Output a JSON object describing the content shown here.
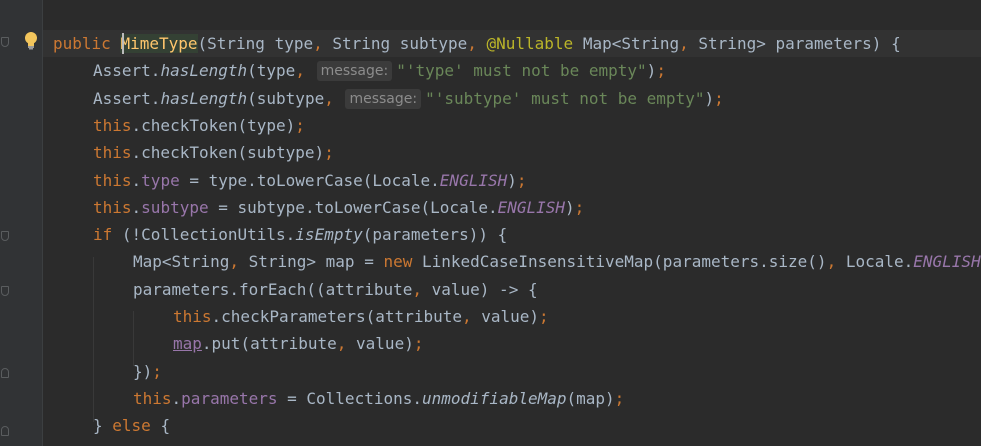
{
  "editor": {
    "lines": [
      {
        "tokens": [
          {
            "t": "public ",
            "c": "kw"
          },
          {
            "t": "MimeType",
            "c": "fn mime-hl"
          },
          {
            "t": "(String type",
            "c": ""
          },
          {
            "t": ", ",
            "c": "kw"
          },
          {
            "t": "String subtype",
            "c": ""
          },
          {
            "t": ", ",
            "c": "kw"
          },
          {
            "t": "@Nullable ",
            "c": "ann"
          },
          {
            "t": "Map<String",
            "c": ""
          },
          {
            "t": ", ",
            "c": "kw"
          },
          {
            "t": "String> parameters) {",
            "c": ""
          }
        ]
      },
      {
        "tokens": [
          {
            "t": "Assert.",
            "c": ""
          },
          {
            "t": "hasLength",
            "c": "static-m"
          },
          {
            "t": "(type",
            "c": ""
          },
          {
            "t": ", ",
            "c": "kw"
          },
          {
            "hint": "message:"
          },
          {
            "t": "\"'type' must not be empty\"",
            "c": "str"
          },
          {
            "t": ")",
            "c": ""
          },
          {
            "t": ";",
            "c": "kw"
          }
        ]
      },
      {
        "tokens": [
          {
            "t": "Assert.",
            "c": ""
          },
          {
            "t": "hasLength",
            "c": "static-m"
          },
          {
            "t": "(subtype",
            "c": ""
          },
          {
            "t": ", ",
            "c": "kw"
          },
          {
            "hint": "message:"
          },
          {
            "t": "\"'subtype' must not be empty\"",
            "c": "str"
          },
          {
            "t": ")",
            "c": ""
          },
          {
            "t": ";",
            "c": "kw"
          }
        ]
      },
      {
        "tokens": [
          {
            "t": "this",
            "c": "kw"
          },
          {
            "t": ".checkToken(type)",
            "c": ""
          },
          {
            "t": ";",
            "c": "kw"
          }
        ]
      },
      {
        "tokens": [
          {
            "t": "this",
            "c": "kw"
          },
          {
            "t": ".checkToken(subtype)",
            "c": ""
          },
          {
            "t": ";",
            "c": "kw"
          }
        ]
      },
      {
        "tokens": [
          {
            "t": "this",
            "c": "kw"
          },
          {
            "t": ".",
            "c": ""
          },
          {
            "t": "type",
            "c": "fld"
          },
          {
            "t": " = type.toLowerCase(Locale.",
            "c": ""
          },
          {
            "t": "ENGLISH",
            "c": "static-fld"
          },
          {
            "t": ")",
            "c": ""
          },
          {
            "t": ";",
            "c": "kw"
          }
        ]
      },
      {
        "tokens": [
          {
            "t": "this",
            "c": "kw"
          },
          {
            "t": ".",
            "c": ""
          },
          {
            "t": "subtype",
            "c": "fld"
          },
          {
            "t": " = subtype.toLowerCase(Locale.",
            "c": ""
          },
          {
            "t": "ENGLISH",
            "c": "static-fld"
          },
          {
            "t": ")",
            "c": ""
          },
          {
            "t": ";",
            "c": "kw"
          }
        ]
      },
      {
        "tokens": [
          {
            "t": "if ",
            "c": "kw"
          },
          {
            "t": "(!CollectionUtils.",
            "c": ""
          },
          {
            "t": "isEmpty",
            "c": "static-m"
          },
          {
            "t": "(parameters)) {",
            "c": ""
          }
        ]
      },
      {
        "tokens": [
          {
            "t": "Map<String",
            "c": ""
          },
          {
            "t": ", ",
            "c": "kw"
          },
          {
            "t": "String> map = ",
            "c": ""
          },
          {
            "t": "new ",
            "c": "kw"
          },
          {
            "t": "LinkedCaseInsensitiveMap(parameters.size()",
            "c": ""
          },
          {
            "t": ", ",
            "c": "kw"
          },
          {
            "t": "Locale.",
            "c": ""
          },
          {
            "t": "ENGLISH",
            "c": "static-fld"
          },
          {
            "t": "))",
            "c": ""
          },
          {
            "t": ";",
            "c": "kw"
          }
        ]
      },
      {
        "tokens": [
          {
            "t": "parameters.forEach((attribute",
            "c": ""
          },
          {
            "t": ", ",
            "c": "kw"
          },
          {
            "t": "value) -> {",
            "c": ""
          }
        ]
      },
      {
        "tokens": [
          {
            "t": "this",
            "c": "kw"
          },
          {
            "t": ".checkParameters(attribute",
            "c": ""
          },
          {
            "t": ", ",
            "c": "kw"
          },
          {
            "t": "value)",
            "c": ""
          },
          {
            "t": ";",
            "c": "kw"
          }
        ]
      },
      {
        "tokens": [
          {
            "t": "map",
            "c": "map-ref"
          },
          {
            "t": ".put(attribute",
            "c": ""
          },
          {
            "t": ", ",
            "c": "kw"
          },
          {
            "t": "value)",
            "c": ""
          },
          {
            "t": ";",
            "c": "kw"
          }
        ]
      },
      {
        "tokens": [
          {
            "t": "})",
            "c": ""
          },
          {
            "t": ";",
            "c": "kw"
          }
        ]
      },
      {
        "tokens": [
          {
            "t": "this",
            "c": "kw"
          },
          {
            "t": ".",
            "c": ""
          },
          {
            "t": "parameters",
            "c": "fld"
          },
          {
            "t": " = Collections.",
            "c": ""
          },
          {
            "t": "unmodifiableMap",
            "c": "static-m"
          },
          {
            "t": "(map)",
            "c": ""
          },
          {
            "t": ";",
            "c": "kw"
          }
        ]
      },
      {
        "tokens": [
          {
            "t": "} ",
            "c": ""
          },
          {
            "t": "else ",
            "c": "kw"
          },
          {
            "t": "{",
            "c": ""
          }
        ]
      }
    ]
  },
  "colors": {
    "background": "#2b2b2b",
    "keyword": "#cc7832",
    "method_decl": "#ffc66d",
    "string": "#6a8759",
    "annotation": "#bbb529",
    "field": "#9876aa",
    "default_text": "#a9b7c6"
  },
  "icons": {
    "intention_bulb": "lightbulb-icon",
    "fold_markers": "fold-marker-icon"
  }
}
